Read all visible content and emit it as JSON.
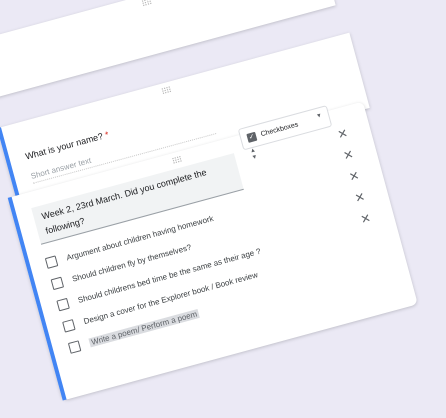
{
  "question1": {
    "title": "What is your name?",
    "required_mark": "*",
    "placeholder": "Short answer text"
  },
  "question2": {
    "title": "Week 2, 23rd March. Did you complete the following?",
    "type_select": {
      "label": "Checkboxes",
      "icon": "checkbox-icon"
    },
    "options": [
      {
        "label": "Argument about children having homework"
      },
      {
        "label": "Should children fly by themselves?"
      },
      {
        "label": "Should childrens bed time be the same as their age ?"
      },
      {
        "label": "Design a cover for the Explorer book / Book review"
      },
      {
        "label": "Write a poem/ Perform a poem"
      }
    ]
  },
  "colors": {
    "accent": "#4285f4",
    "background": "#ebe9f5",
    "required": "#d93025"
  }
}
